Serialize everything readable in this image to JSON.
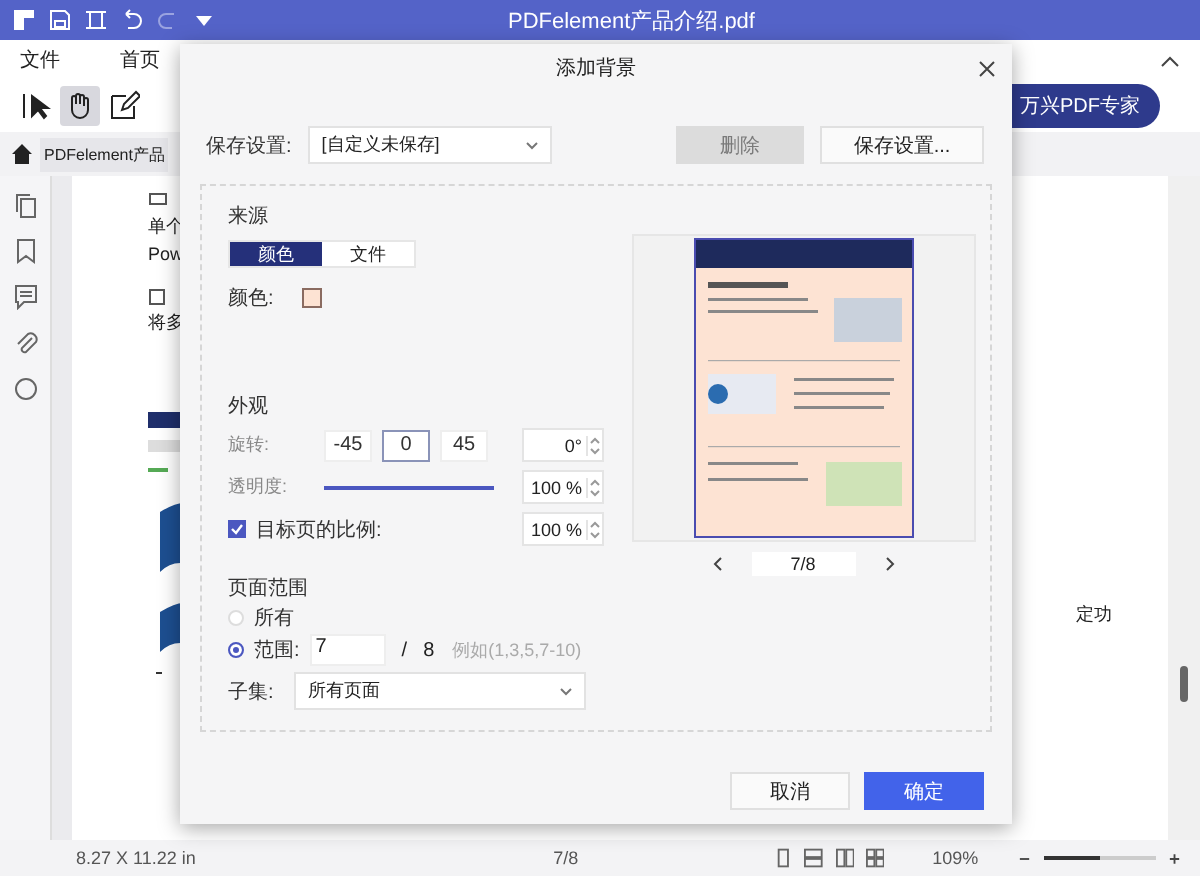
{
  "window": {
    "title": "PDFelement产品介绍.pdf"
  },
  "menu": [
    {
      "label": "文件"
    },
    {
      "label": "首页"
    }
  ],
  "toolbar": {
    "tools": [
      {
        "kind": "select",
        "selected": false
      },
      {
        "kind": "hand",
        "selected": true
      },
      {
        "kind": "edit",
        "selected": false
      }
    ],
    "account_button": "万兴PDF专家"
  },
  "document_tab": "PDFelement产品",
  "document": {
    "texts": [
      "单个",
      "Pow",
      "将多",
      "定功"
    ]
  },
  "dialog": {
    "title": "添加背景",
    "save_settings": {
      "label": "保存设置:",
      "value": "[自定义未保存]"
    },
    "delete_button": {
      "label": "删除",
      "disabled": true
    },
    "save_button": "保存设置...",
    "source": {
      "heading": "来源",
      "tabs": [
        {
          "label": "颜色",
          "selected": true
        },
        {
          "label": "文件",
          "selected": false
        }
      ],
      "color_label": "颜色:"
    },
    "appearance": {
      "heading": "外观",
      "rotation": {
        "label": "旋转:",
        "options": [
          {
            "label": "-45",
            "selected": false
          },
          {
            "label": "0",
            "selected": true
          },
          {
            "label": "45",
            "selected": false
          }
        ],
        "value": "0°"
      },
      "opacity": {
        "label": "透明度:",
        "level": 1,
        "value": "100 %"
      },
      "scale": {
        "label": "目标页的比例:",
        "checked": true,
        "value": "100 %"
      }
    },
    "page_range": {
      "heading": "页面范围",
      "options": [
        {
          "label": "所有",
          "selected": false
        },
        {
          "label": "范围:",
          "selected": true
        }
      ],
      "from": "7",
      "separator": "/",
      "total": "8",
      "hint": "例如(1,3,5,7-10)",
      "subset_label": "子集:",
      "subset": "所有页面"
    },
    "preview": {
      "page": "7/8"
    },
    "buttons": [
      {
        "label": "取消",
        "kind": "secondary"
      },
      {
        "label": "确定",
        "kind": "primary"
      }
    ]
  },
  "status": {
    "size": "8.27 X 11.22 in",
    "page": "7/8",
    "zoom": "109%",
    "zoom_slider": {
      "level": 0.5
    }
  }
}
